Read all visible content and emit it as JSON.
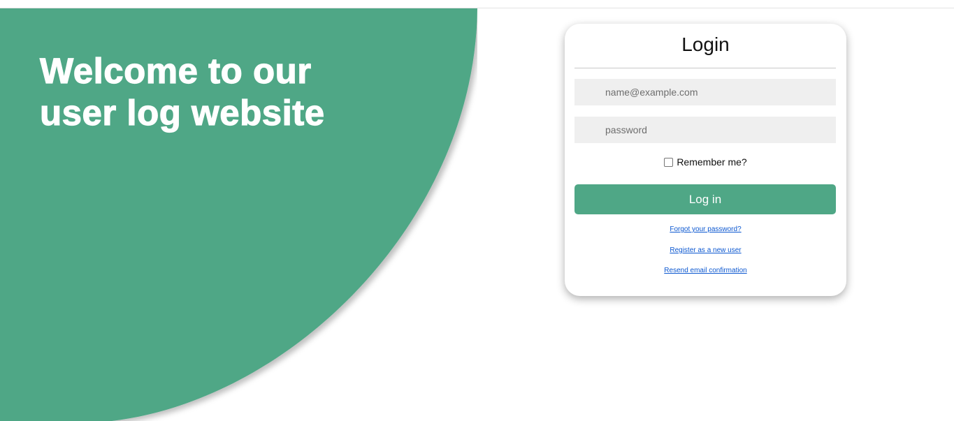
{
  "hero": {
    "title": "Welcome to our user log website"
  },
  "login": {
    "title": "Login",
    "email_placeholder": "name@example.com",
    "password_placeholder": "password",
    "remember_label": "Remember me?",
    "remember_checked": false,
    "submit_label": "Log in",
    "links": {
      "forgot": "Forgot your password?",
      "register": "Register as a new user",
      "resend": "Resend email confirmation"
    }
  },
  "colors": {
    "accent": "#4fa786",
    "card_background": "#ffffff",
    "input_background": "#efefef",
    "link": "#0b57d0"
  }
}
